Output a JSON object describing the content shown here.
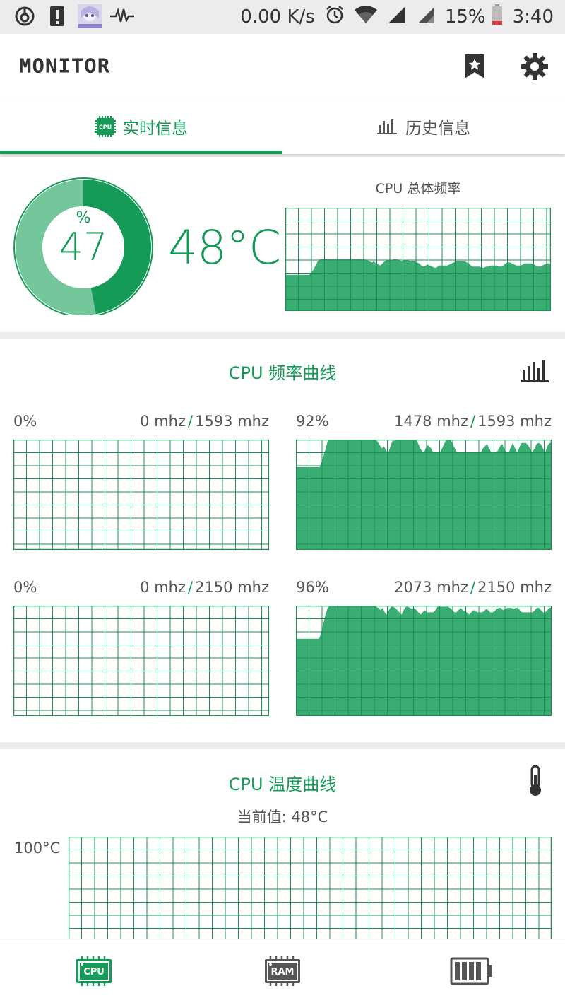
{
  "status_bar": {
    "net_speed": "0.00 K/s",
    "battery_percent": "15%",
    "time": "3:40",
    "icons": [
      "headphone-app-icon",
      "alert-icon",
      "avatar-icon",
      "pulse-icon",
      "alarm-icon",
      "wifi-icon",
      "signal-icon",
      "signal-icon-2",
      "battery-icon"
    ]
  },
  "app": {
    "title": "MONITOR",
    "actions": [
      "bookmark-star-icon",
      "settings-gear-icon"
    ]
  },
  "tabs": [
    {
      "label": "实时信息",
      "icon": "cpu-chip-icon",
      "active": true
    },
    {
      "label": "历史信息",
      "icon": "bar-chart-icon",
      "active": false
    }
  ],
  "overview": {
    "load_unit": "%",
    "load_value": "47",
    "load_fraction": 0.47,
    "temperature": "48°C",
    "total_freq_title": "CPU 总体频率"
  },
  "colors": {
    "accent": "#169a58",
    "fill": "#3aad72",
    "ring_light": "#74c79b",
    "grid": "#1e8f55"
  },
  "freq_section": {
    "title": "CPU 频率曲线",
    "icon": "bar-chart-icon",
    "separator": "/",
    "cores": [
      {
        "percent": "0%",
        "current": "0 mhz",
        "max": "1593 mhz"
      },
      {
        "percent": "92%",
        "current": "1478 mhz",
        "max": "1593 mhz"
      },
      {
        "percent": "0%",
        "current": "0 mhz",
        "max": "2150 mhz"
      },
      {
        "percent": "96%",
        "current": "2073 mhz",
        "max": "2150 mhz"
      }
    ]
  },
  "temp_section": {
    "title": "CPU 温度曲线",
    "icon": "thermometer-icon",
    "current_label": "当前值: 48°C",
    "y_max_label": "100°C"
  },
  "bottom_nav": [
    {
      "name": "CPU",
      "active": true
    },
    {
      "name": "RAM",
      "active": false
    },
    {
      "name": "battery",
      "active": false
    }
  ],
  "chart_data": [
    {
      "type": "area",
      "title": "CPU 总体频率",
      "ylim": [
        0,
        100
      ],
      "grid": true,
      "values": [
        35,
        35,
        35,
        35,
        35,
        35,
        35,
        35,
        35,
        35,
        35,
        35,
        37,
        40,
        44,
        48,
        50,
        50,
        50,
        50,
        50,
        50,
        50,
        50,
        50,
        50,
        50,
        50,
        50,
        50,
        50,
        50,
        50,
        50,
        50,
        50,
        50,
        50,
        49,
        48,
        47,
        48,
        46,
        45,
        44,
        46,
        48,
        49,
        49,
        49,
        50,
        50,
        50,
        49,
        48,
        49,
        49,
        49,
        48,
        48,
        48,
        47,
        46,
        44,
        43,
        44,
        45,
        44,
        43,
        42,
        42,
        44,
        44,
        44,
        44,
        44,
        45,
        46,
        47,
        48,
        48,
        48,
        48,
        48,
        47,
        46,
        44,
        43,
        43,
        43,
        43,
        42,
        42,
        43,
        43,
        44,
        44,
        44,
        44,
        43,
        43,
        44,
        46,
        47,
        47,
        46,
        45,
        44,
        44,
        44,
        45,
        46,
        46,
        46,
        46,
        45,
        44,
        43,
        43,
        44,
        45,
        46,
        46,
        45
      ]
    },
    {
      "type": "area",
      "title": "0%",
      "ylim": [
        0,
        100
      ],
      "grid": true,
      "values": [
        0,
        0,
        0,
        0,
        0,
        0,
        0,
        0,
        0,
        0,
        0,
        0,
        0,
        0,
        0,
        0,
        0,
        0,
        0,
        0
      ]
    },
    {
      "type": "area",
      "title": "92%",
      "ylim": [
        0,
        100
      ],
      "grid": true,
      "values": [
        75,
        75,
        75,
        75,
        75,
        75,
        75,
        75,
        75,
        75,
        75,
        75,
        80,
        86,
        93,
        100,
        100,
        100,
        100,
        100,
        100,
        100,
        100,
        100,
        100,
        100,
        100,
        100,
        100,
        100,
        100,
        100,
        100,
        100,
        100,
        100,
        100,
        100,
        98,
        95,
        92,
        94,
        90,
        88,
        94,
        99,
        99,
        100,
        100,
        100,
        100,
        100,
        100,
        100,
        100,
        100,
        100,
        96,
        92,
        88,
        90,
        95,
        94,
        92,
        88,
        88,
        88,
        88,
        92,
        96,
        100,
        100,
        100,
        96,
        92,
        88,
        88,
        88,
        88,
        88,
        88,
        88,
        88,
        88,
        88,
        88,
        88,
        92,
        94,
        96,
        92,
        88,
        88,
        88,
        90,
        94,
        96,
        92,
        88,
        88,
        93,
        97,
        92,
        88,
        93,
        97,
        97,
        97,
        95,
        92,
        88,
        92,
        96,
        97,
        96,
        92,
        88,
        94,
        97,
        97
      ]
    },
    {
      "type": "area",
      "title": "0%",
      "ylim": [
        0,
        100
      ],
      "grid": true,
      "values": [
        0,
        0,
        0,
        0,
        0,
        0,
        0,
        0,
        0,
        0,
        0,
        0,
        0,
        0,
        0,
        0,
        0,
        0,
        0,
        0
      ]
    },
    {
      "type": "area",
      "title": "96%",
      "ylim": [
        0,
        100
      ],
      "grid": true,
      "values": [
        70,
        70,
        70,
        70,
        70,
        70,
        70,
        70,
        70,
        70,
        70,
        70,
        76,
        84,
        92,
        98,
        100,
        100,
        100,
        100,
        100,
        100,
        100,
        100,
        100,
        100,
        100,
        100,
        100,
        100,
        100,
        100,
        100,
        100,
        100,
        100,
        100,
        100,
        99,
        98,
        96,
        98,
        94,
        92,
        96,
        99,
        99,
        98,
        96,
        94,
        92,
        96,
        99,
        99,
        98,
        97,
        98,
        96,
        94,
        92,
        94,
        96,
        94,
        94,
        94,
        94,
        96,
        99,
        99,
        99,
        99,
        99,
        99,
        98,
        96,
        94,
        94,
        96,
        98,
        96,
        95,
        94,
        92,
        94,
        96,
        95,
        94,
        94,
        94,
        95,
        97,
        96,
        94,
        94,
        95,
        97,
        98,
        98,
        96,
        97,
        98,
        98,
        98,
        97,
        98,
        98,
        96,
        94,
        94,
        94,
        94,
        94,
        94,
        96,
        98,
        98,
        96,
        94,
        94,
        96,
        98,
        98
      ]
    },
    {
      "type": "line",
      "title": "CPU 温度曲线",
      "ylabel": "100°C",
      "grid": true,
      "values": []
    }
  ]
}
